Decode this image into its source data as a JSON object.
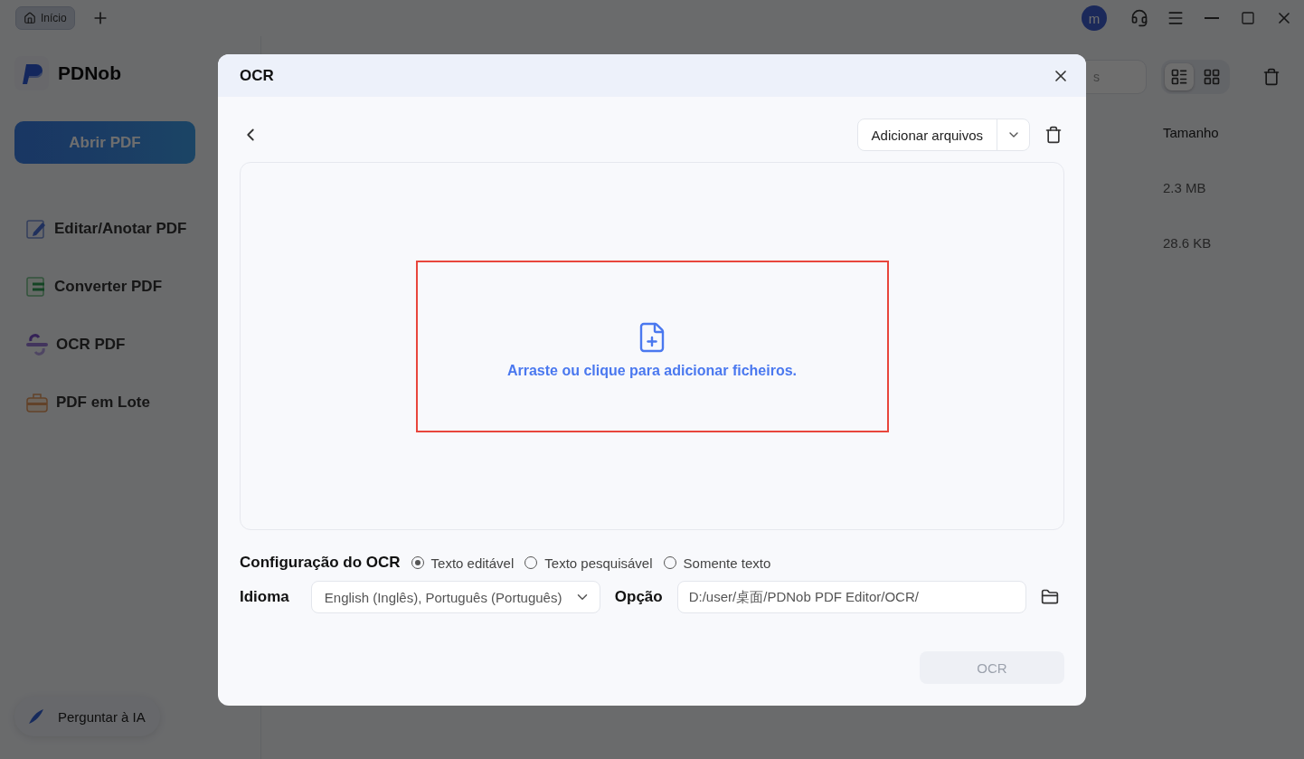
{
  "tabs": [
    {
      "label": "Início",
      "selected": true
    }
  ],
  "user": {
    "avatar_letter": "m"
  },
  "app": {
    "name": "PDNob"
  },
  "sidebar": {
    "primary_button": "Abrir PDF",
    "items": [
      {
        "label": "Editar/Anotar PDF",
        "kind": "edit"
      },
      {
        "label": "Converter PDF",
        "kind": "convert"
      },
      {
        "label": "OCR PDF",
        "kind": "ocr"
      },
      {
        "label": "PDF em Lote",
        "kind": "batch"
      }
    ],
    "ask_ai": "Perguntar à IA"
  },
  "toolbar": {
    "search": {
      "placeholder": "s"
    },
    "views": [
      {
        "kind": "list",
        "selected": true
      },
      {
        "kind": "grid",
        "selected": false
      }
    ]
  },
  "table": {
    "columns": [
      "Tamanho"
    ],
    "rows": [
      {
        "size": "2.3 MB"
      },
      {
        "size": "28.6 KB"
      }
    ]
  },
  "dialog": {
    "title": "OCR",
    "add_button": "Adicionar arquivos",
    "dropzone": {
      "text": "Arraste ou clique para adicionar ficheiros.",
      "highlighted": true
    },
    "config": {
      "label": "Configuração do OCR",
      "options": [
        {
          "label": "Texto editável",
          "selected": true
        },
        {
          "label": "Texto pesquisável",
          "selected": false
        },
        {
          "label": "Somente texto",
          "selected": false
        }
      ]
    },
    "language": {
      "label": "Idioma",
      "value": "English (Inglês), Português (Português)"
    },
    "output": {
      "label": "Opção",
      "value": "D:/user/桌面/PDNob PDF Editor/OCR/"
    },
    "submit": {
      "label": "OCR",
      "disabled": true
    }
  }
}
